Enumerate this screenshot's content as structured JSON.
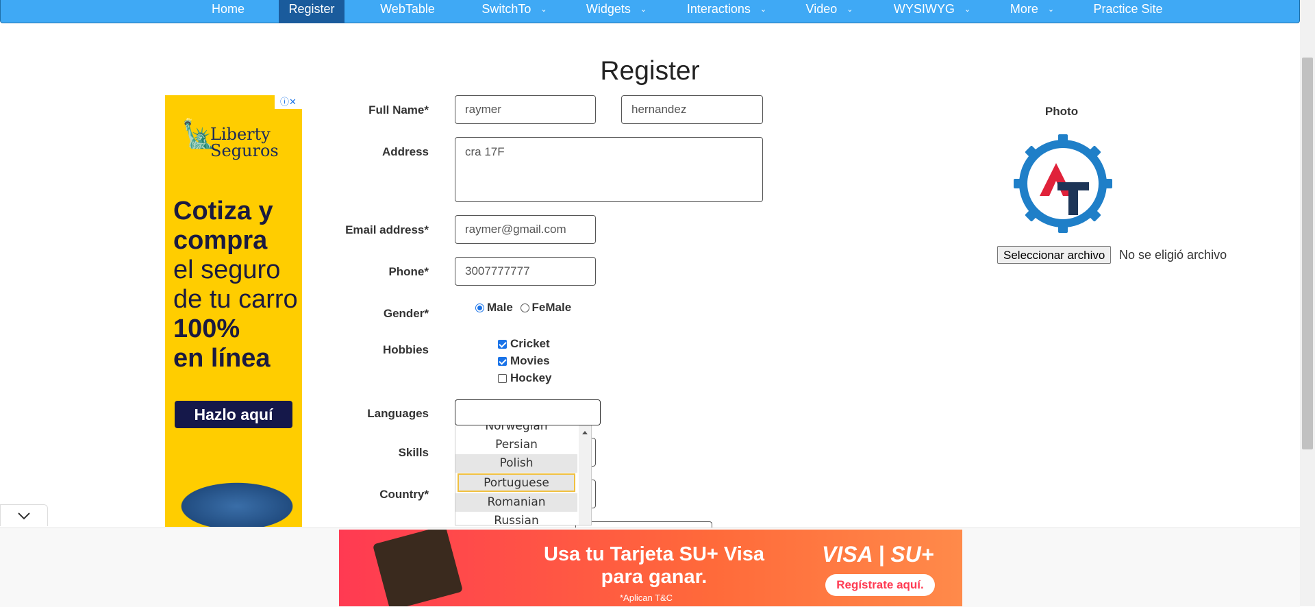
{
  "nav": {
    "items": [
      {
        "label": "Home"
      },
      {
        "label": "Register"
      },
      {
        "label": "WebTable"
      },
      {
        "label": "SwitchTo"
      },
      {
        "label": "Widgets"
      },
      {
        "label": "Interactions"
      },
      {
        "label": "Video"
      },
      {
        "label": "WYSIWYG"
      },
      {
        "label": "More"
      },
      {
        "label": "Practice Site"
      }
    ],
    "active": "Register",
    "caret": "⌄"
  },
  "page_title": "Register",
  "form": {
    "full_name_label": "Full Name*",
    "first_name": "raymer",
    "last_name": "hernandez",
    "address_label": "Address",
    "address": "cra 17F",
    "email_label": "Email address*",
    "email": "raymer@gmail.com",
    "phone_label": "Phone*",
    "phone": "3007777777",
    "gender_label": "Gender*",
    "gender_options": {
      "male": "Male",
      "female": "FeMale"
    },
    "gender_selected": "Male",
    "hobbies_label": "Hobbies",
    "hobbies": [
      {
        "label": "Cricket",
        "checked": true
      },
      {
        "label": "Movies",
        "checked": true
      },
      {
        "label": "Hockey",
        "checked": false
      }
    ],
    "languages_label": "Languages",
    "languages_value": "",
    "language_options": [
      "Norwegian",
      "Persian",
      "Polish",
      "Portuguese",
      "Romanian",
      "Russian"
    ],
    "language_highlighted": "Portuguese",
    "skills_label": "Skills",
    "country_label": "Country*"
  },
  "photo": {
    "label": "Photo",
    "file_button": "Seleccionar archivo",
    "file_status": "No se eligió archivo",
    "logo_colors": {
      "gear": "#1f7fc8",
      "a": "#e0223a",
      "t": "#1d3557"
    }
  },
  "ads": {
    "left": {
      "choices": "ⓘ✕",
      "brand": "Liberty Seguros",
      "line1": "Cotiza y",
      "line2": "compra",
      "line3": "el seguro",
      "line4": "de tu carro",
      "line5": "100%",
      "line6": "en línea",
      "cta": "Hazlo aquí"
    },
    "bottom": {
      "message": "Usa tu Tarjeta SU+ Visa para ganar.",
      "terms": "*Aplican T&C",
      "brand": "VISA | SU+",
      "cta": "Regístrate aquí."
    }
  }
}
